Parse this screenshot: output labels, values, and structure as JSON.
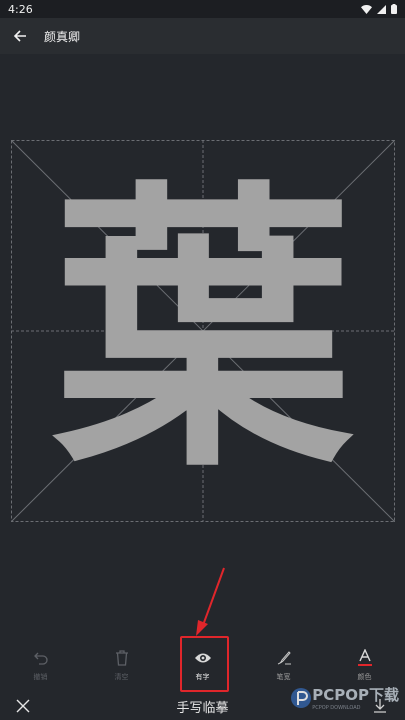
{
  "status": {
    "time": "4:26"
  },
  "header": {
    "title": "颜真卿"
  },
  "canvas": {
    "character": "葉"
  },
  "toolbar": {
    "items": [
      {
        "label": "撤销",
        "icon": "undo-icon",
        "state": "disabled"
      },
      {
        "label": "清空",
        "icon": "trash-icon",
        "state": "disabled"
      },
      {
        "label": "有字",
        "icon": "eye-icon",
        "state": "active"
      },
      {
        "label": "笔宽",
        "icon": "brush-icon",
        "state": "normal"
      },
      {
        "label": "颜色",
        "icon": "font-color-icon",
        "state": "normal"
      }
    ]
  },
  "bottom": {
    "title": "手写临摹"
  },
  "watermark": {
    "text": "PCPOP下载",
    "sub": "PCPOP DOWNLOAD"
  },
  "colors": {
    "background": "#24272c",
    "accent_red": "#e0262b",
    "glyph": "#a3a3a3"
  }
}
